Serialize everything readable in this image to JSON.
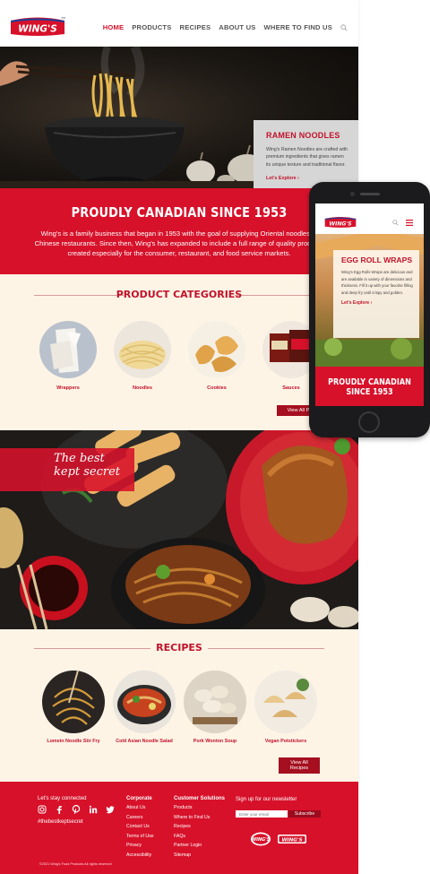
{
  "colors": {
    "brand_red": "#d7112a",
    "dark_red": "#a50f1f",
    "cream": "#fdf4e6"
  },
  "brand": {
    "logo": "WING'S",
    "tm": "TM"
  },
  "nav": {
    "items": [
      {
        "label": "HOME",
        "active": true
      },
      {
        "label": "PRODUCTS",
        "active": false
      },
      {
        "label": "RECIPES",
        "active": false
      },
      {
        "label": "ABOUT US",
        "active": false
      },
      {
        "label": "WHERE TO FIND US",
        "active": false
      }
    ],
    "search_icon": "search-icon"
  },
  "hero": {
    "card_title": "RAMEN NOODLES",
    "card_text": "Wing's Ramen Noodles are crafted with premium ingredients that gives ramen its unique texture and traditional flavor.",
    "card_link": "Let's Explore"
  },
  "canadian": {
    "title": "PROUDLY CANADIAN SINCE 1953",
    "text": "Wing's is a family business that began in 1953 with the goal of supplying Oriental noodles to Chinese restaurants. Since then, Wing's has expanded to include a full range of quality products created especially for the consumer, restaurant, and food service markets."
  },
  "categories": {
    "heading": "PRODUCT CATEGORIES",
    "items": [
      {
        "label": "Wrappers"
      },
      {
        "label": "Noodles"
      },
      {
        "label": "Cookies"
      },
      {
        "label": "Sauces"
      }
    ],
    "view_all": "View All Prod"
  },
  "feature": {
    "tagline_line1": "The best",
    "tagline_line2": "kept secret"
  },
  "recipes": {
    "heading": "RECIPES",
    "items": [
      {
        "label": "Lomein Noodle Stir Fry"
      },
      {
        "label": "Cold Asian Noodle Salad"
      },
      {
        "label": "Pork Wonton Soup"
      },
      {
        "label": "Vegan Potstickers"
      }
    ],
    "view_all": "View All Recipes"
  },
  "footer": {
    "connect_label": "Let's stay connected",
    "hashtag": "#thebestkeptsecret",
    "corporate_title": "Corporate",
    "corporate_links": [
      "About Us",
      "Careers",
      "Contact Us",
      "Terms of Use",
      "Privacy",
      "Accessibility"
    ],
    "customer_title": "Customer Solutions",
    "customer_links": [
      "Products",
      "Where to Find Us",
      "Recipes",
      "FAQs",
      "Partner Login",
      "Sitemap"
    ],
    "newsletter_label": "Sign up for our newsletter",
    "newsletter_placeholder": "Enter your email",
    "subscribe": "Subscribe",
    "copyright": "©2021 Wing's Food Products All rights reserved"
  },
  "phone": {
    "card_title": "EGG ROLL WRAPS",
    "card_text": "Wing's Egg Rolls Wraps are delicious and are available in variety of dimensions and thickness. Fill it up with your favorite filling and deep fry until crispy and golden.",
    "card_link": "Let's Explore",
    "banner_line1": "PROUDLY CANADIAN",
    "banner_line2": "SINCE 1953"
  }
}
